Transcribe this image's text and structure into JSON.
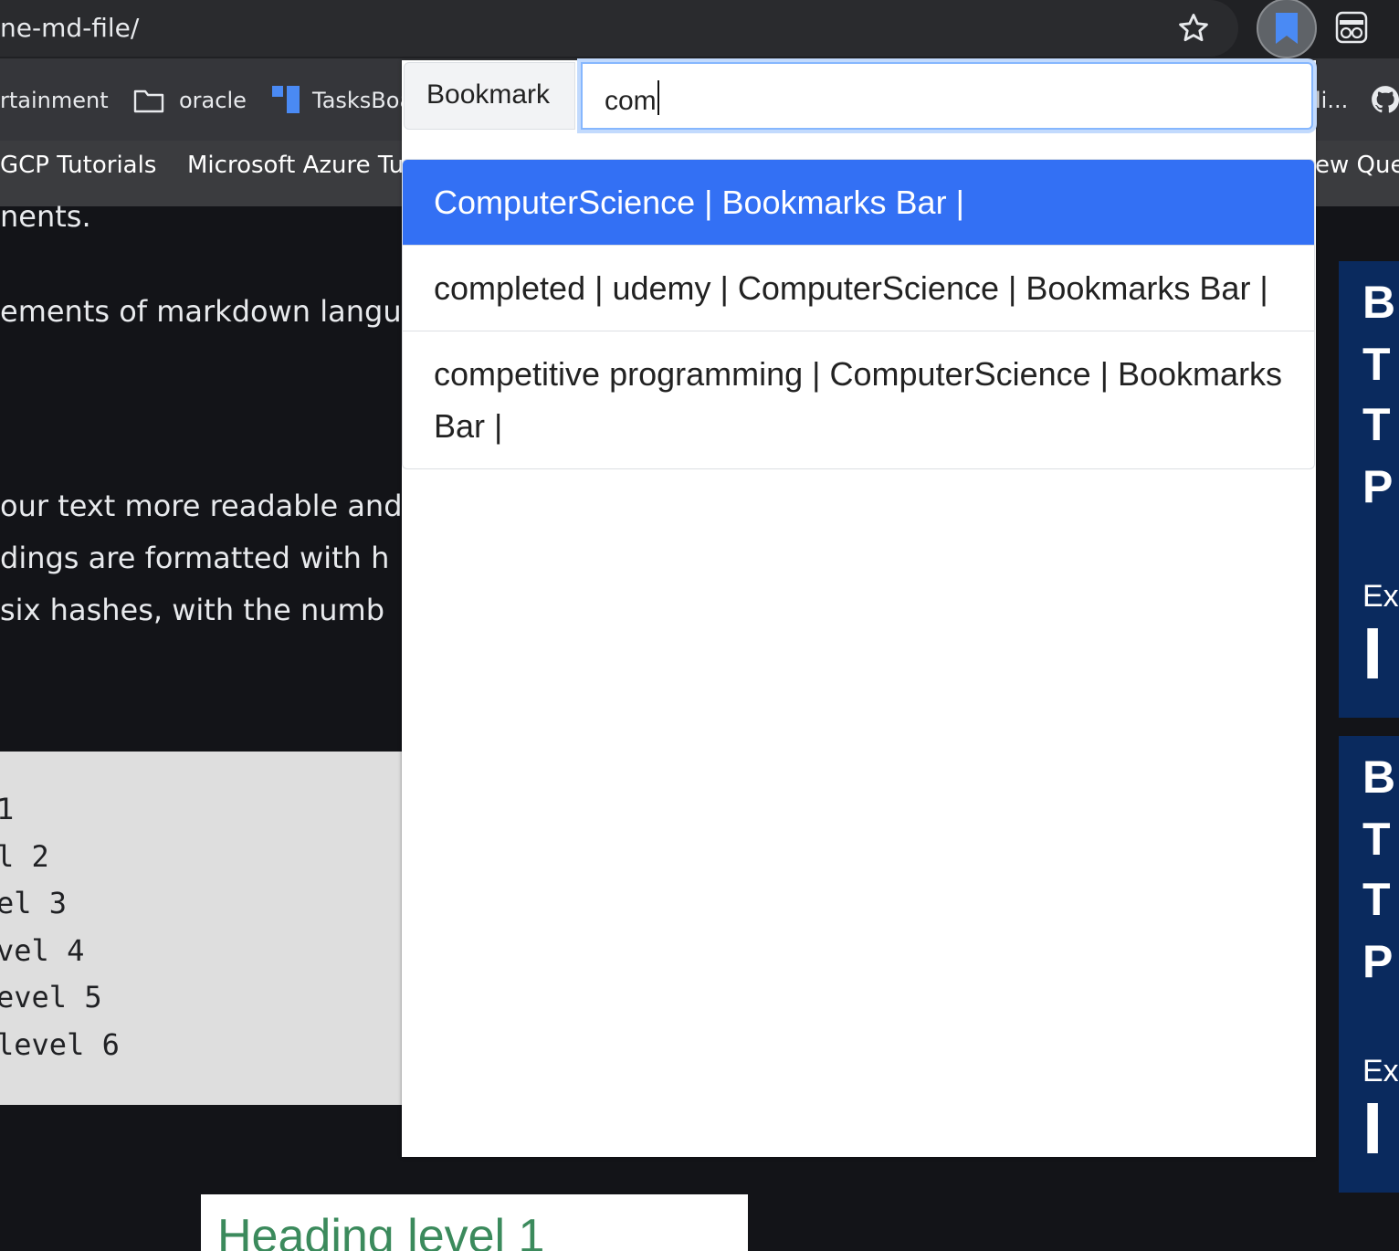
{
  "browser": {
    "url_fragment": "ne-md-file/",
    "bookmarks_row1": [
      {
        "label": "rtainment"
      },
      {
        "label": "oracle"
      },
      {
        "label": "TasksBoa"
      },
      {
        "label": "li..."
      }
    ],
    "bookmarks_row2": [
      {
        "label": "GCP Tutorials"
      },
      {
        "label": "Microsoft Azure Tut"
      },
      {
        "label": "ew Que"
      }
    ]
  },
  "page": {
    "lines": [
      "nents.",
      "ements of markdown langu",
      "our text more readable and",
      "dings are formatted with h",
      " six hashes, with the numb"
    ],
    "code_lines": [
      " 1",
      "l 2",
      "el 3",
      "vel 4",
      "evel 5",
      "level 6"
    ],
    "heading": "Heading level 1"
  },
  "ads": {
    "top": {
      "letters": [
        "B",
        "T",
        "T",
        "P"
      ],
      "small": "Ex"
    },
    "bottom": {
      "letters": [
        "B",
        "T",
        "T",
        "P"
      ],
      "small": "Ex"
    }
  },
  "popup": {
    "addon_label": "Bookmark",
    "search_value": "com",
    "results": [
      {
        "text": "ComputerScience | Bookmarks Bar |",
        "active": true
      },
      {
        "text": "completed | udemy | ComputerScience | Bookmarks Bar |",
        "active": false
      },
      {
        "text": "competitive programming | ComputerScience | Bookmarks Bar |",
        "active": false
      }
    ]
  },
  "colors": {
    "accent": "#3370f4",
    "focus_ring": "#86b7fe"
  }
}
